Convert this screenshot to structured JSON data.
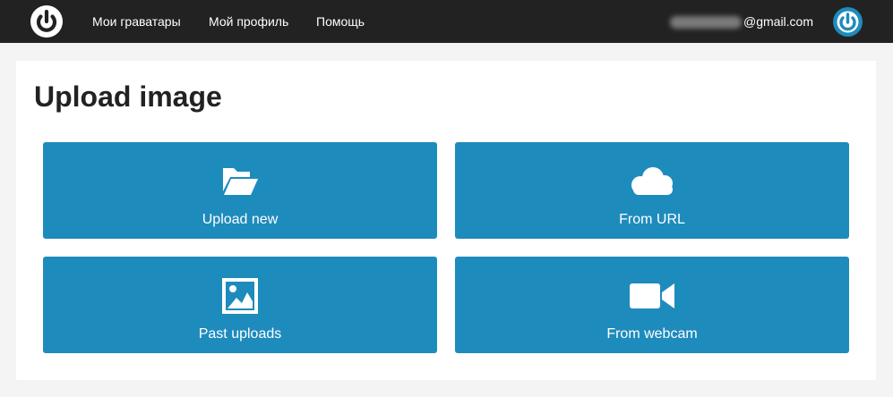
{
  "header": {
    "nav": [
      "Мои граватары",
      "Мой профиль",
      "Помощь"
    ],
    "email_suffix": "@gmail.com",
    "logo_icon": "gravatar-logo-icon",
    "avatar_icon": "gravatar-avatar-icon"
  },
  "main": {
    "title": "Upload image",
    "tiles": [
      {
        "label": "Upload new",
        "icon": "folder-open-icon"
      },
      {
        "label": "From URL",
        "icon": "cloud-icon"
      },
      {
        "label": "Past uploads",
        "icon": "image-icon"
      },
      {
        "label": "From webcam",
        "icon": "video-camera-icon"
      }
    ]
  },
  "colors": {
    "topbar": "#222222",
    "accent": "#1e8bbd",
    "background": "#f4f4f4"
  }
}
